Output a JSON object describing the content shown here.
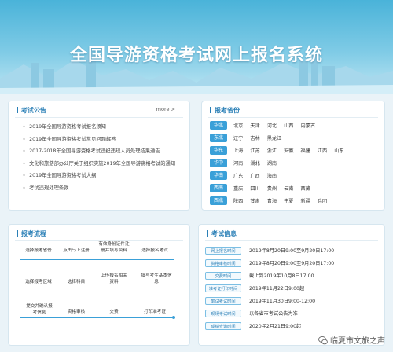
{
  "banner": {
    "title": "全国导游资格考试网上报名系统"
  },
  "notices": {
    "title": "考试公告",
    "more": "more >",
    "items": [
      "2019年全国导游资格考试报名须知",
      "2019年全国导游资格考试常见问题解答",
      "2017-2018年全国导游资格考试违纪违规人员处理结果通告",
      "文化和旅游部办公厅关于组织实施2019年全国导游资格考试的通知",
      "2019年全国导游资格考试大纲",
      "考试违规处理条款"
    ]
  },
  "provinces": {
    "title": "报考省份",
    "regions": [
      {
        "tag": "华北",
        "items": [
          "北京",
          "天津",
          "河北",
          "山西",
          "内蒙古"
        ]
      },
      {
        "tag": "东北",
        "items": [
          "辽宁",
          "吉林",
          "黑龙江"
        ]
      },
      {
        "tag": "华东",
        "items": [
          "上海",
          "江苏",
          "浙江",
          "安徽",
          "福建",
          "江西",
          "山东"
        ]
      },
      {
        "tag": "华中",
        "items": [
          "河南",
          "湖北",
          "湖南"
        ]
      },
      {
        "tag": "华南",
        "items": [
          "广东",
          "广西",
          "海南"
        ]
      },
      {
        "tag": "西南",
        "items": [
          "重庆",
          "四川",
          "贵州",
          "云南",
          "西藏"
        ]
      },
      {
        "tag": "西北",
        "items": [
          "陕西",
          "甘肃",
          "青海",
          "宁夏",
          "新疆",
          "兵团"
        ]
      }
    ]
  },
  "flow": {
    "title": "报考流程",
    "row1": [
      "选择报考省份",
      "点击马上注册",
      "有效身份证件注\n册并填写资料",
      "选择报名考试"
    ],
    "row2": [
      "选择报考区域",
      "选择科目",
      "上传报名相关\n资料",
      "填写考生基本信\n息"
    ],
    "row3": [
      "提交并确认报\n考信息",
      "资格审核",
      "交费",
      "打印准考证"
    ]
  },
  "schedule": {
    "title": "考试信息",
    "rows": [
      {
        "tag": "网上报名时间",
        "value": "2019年8月20日9:00至9月20日17:00"
      },
      {
        "tag": "资格审核时间",
        "value": "2019年8月20日9:00至9月20日17:00"
      },
      {
        "tag": "交费时间",
        "value": "截止到2019年10月8日17:00"
      },
      {
        "tag": "准考证打印时间",
        "value": "2019年11月22日9:00起"
      },
      {
        "tag": "笔试考试时间",
        "value": "2019年11月30日9:00-12:00"
      },
      {
        "tag": "现场考试时间",
        "value": "以各省市考试公告为准"
      },
      {
        "tag": "成绩查询时间",
        "value": "2020年2月21日9:00起"
      }
    ]
  },
  "footer": {
    "account": "临夏市文旅之声"
  }
}
